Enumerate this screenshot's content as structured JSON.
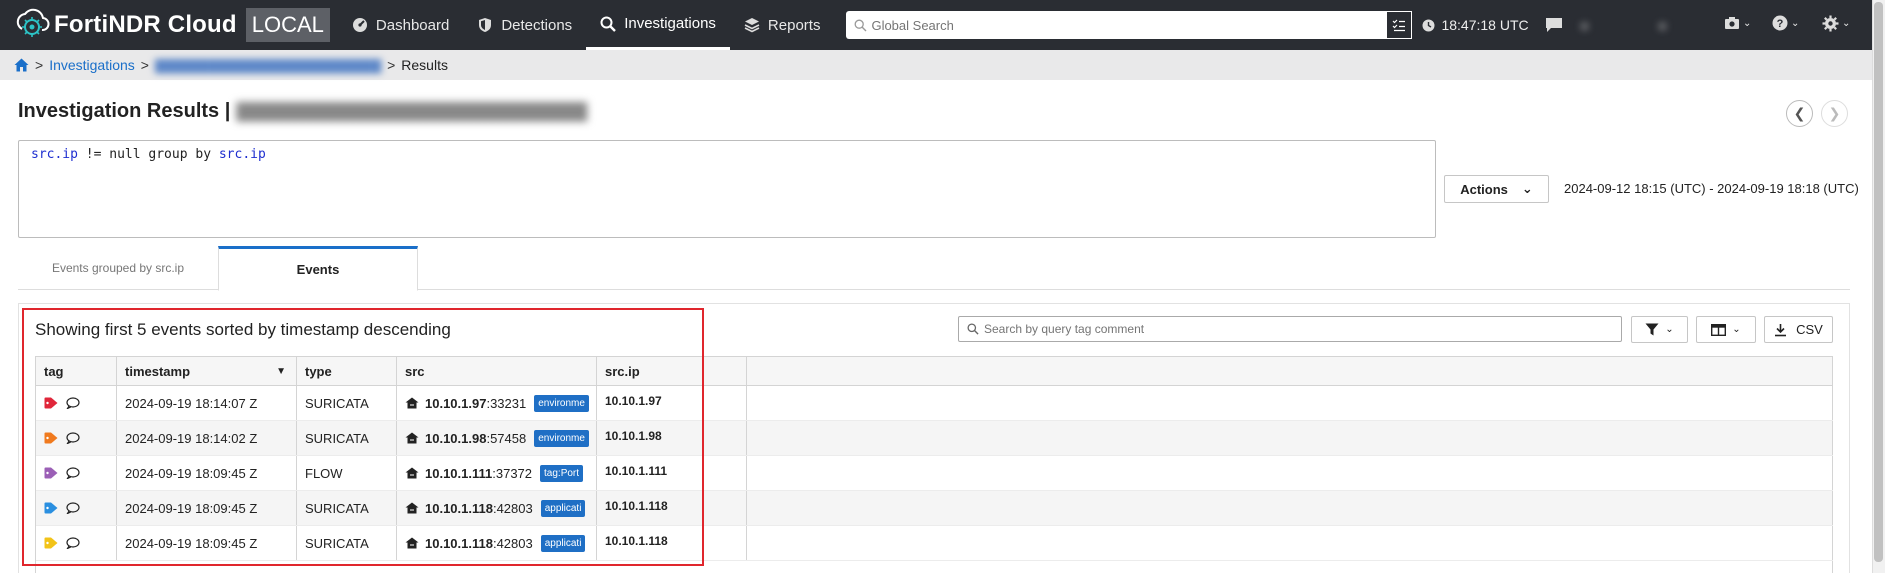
{
  "app": {
    "name": "FortiNDR Cloud",
    "env_badge": "LOCAL"
  },
  "nav": {
    "items": [
      {
        "label": "Dashboard",
        "icon": "dashboard-icon"
      },
      {
        "label": "Detections",
        "icon": "shield-icon"
      },
      {
        "label": "Investigations",
        "icon": "search-icon",
        "active": true
      },
      {
        "label": "Reports",
        "icon": "layers-icon"
      }
    ],
    "search_placeholder": "Global Search",
    "time": "18:47:18 UTC"
  },
  "breadcrumb": {
    "investigations": "Investigations",
    "current": "Results"
  },
  "page": {
    "title": "Investigation Results |",
    "query_parts": [
      "src.ip",
      " != null group by ",
      "src.ip"
    ],
    "actions_label": "Actions",
    "date_range": "2024-09-12 18:15 (UTC) - 2024-09-19 18:18 (UTC)"
  },
  "tabs": [
    {
      "label": "Events grouped by src.ip",
      "active": false
    },
    {
      "label": "Events",
      "active": true
    }
  ],
  "results": {
    "showing_text": "Showing first 5 events sorted by timestamp descending",
    "tag_search_placeholder": "Search by query tag comment",
    "csv_label": "CSV",
    "columns": [
      "tag",
      "timestamp",
      "type",
      "src",
      "src.ip"
    ],
    "rows": [
      {
        "tag_color": "#e0263a",
        "timestamp": "2024-09-19 18:14:07 Z",
        "type": "SURICATA",
        "src_ip": "10.10.1.97",
        "src_port": ":33231",
        "pill": "environme",
        "srcip": "10.10.1.97"
      },
      {
        "tag_color": "#f07a1e",
        "timestamp": "2024-09-19 18:14:02 Z",
        "type": "SURICATA",
        "src_ip": "10.10.1.98",
        "src_port": ":57458",
        "pill": "environme",
        "srcip": "10.10.1.98"
      },
      {
        "tag_color": "#9b5fb6",
        "timestamp": "2024-09-19 18:09:45 Z",
        "type": "FLOW",
        "src_ip": "10.10.1.111",
        "src_port": ":37372",
        "pill": "tag:Port",
        "srcip": "10.10.1.111"
      },
      {
        "tag_color": "#2a8fe0",
        "timestamp": "2024-09-19 18:09:45 Z",
        "type": "SURICATA",
        "src_ip": "10.10.1.118",
        "src_port": ":42803",
        "pill": "applicati",
        "srcip": "10.10.1.118"
      },
      {
        "tag_color": "#f2c318",
        "timestamp": "2024-09-19 18:09:45 Z",
        "type": "SURICATA",
        "src_ip": "10.10.1.118",
        "src_port": ":42803",
        "pill": "applicati",
        "srcip": "10.10.1.118"
      }
    ]
  },
  "colors": {
    "nav_bg": "#2a2d33",
    "link": "#1a6fc9",
    "highlight_frame": "#e0262d",
    "pill": "#1f6fc5"
  }
}
